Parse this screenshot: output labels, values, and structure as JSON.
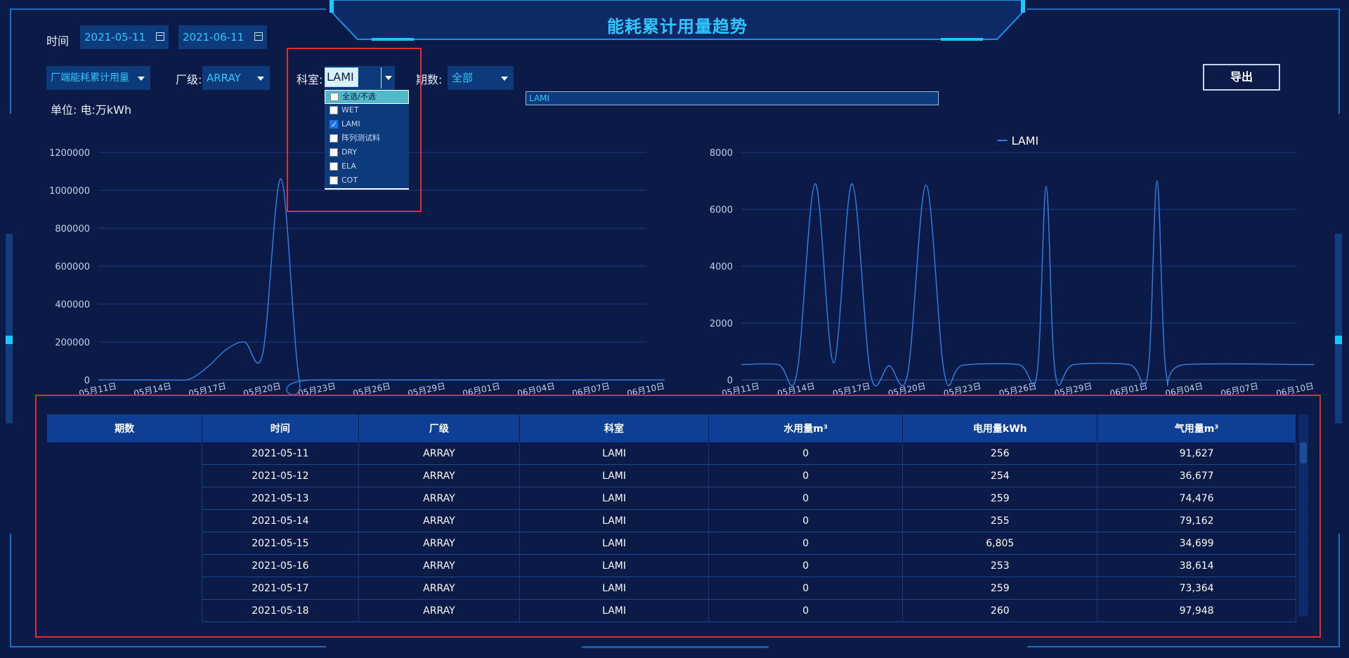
{
  "header": {
    "title": "能耗累计用量趋势"
  },
  "filters": {
    "time_label": "时间",
    "start_date": "2021-05-11",
    "end_date": "2021-06-11",
    "metric_select": "厂端能耗累计用量",
    "factory_label": "厂级:",
    "factory_value": "ARRAY",
    "dept_label": "科室:",
    "dept_value": "LAMI",
    "phase_label": "期数:",
    "phase_value": "全部",
    "export_label": "导出",
    "unit_label": "单位: 电:万kWh",
    "selected_chip": "LAMI"
  },
  "dept_dropdown": {
    "items": [
      {
        "label": "全选/不选",
        "checked": false
      },
      {
        "label": "WET",
        "checked": false
      },
      {
        "label": "LAMI",
        "checked": true
      },
      {
        "label": "阵列测试料",
        "checked": false
      },
      {
        "label": "DRY",
        "checked": false
      },
      {
        "label": "ELA",
        "checked": false
      },
      {
        "label": "COT",
        "checked": false
      }
    ]
  },
  "chart_data": [
    {
      "type": "line",
      "title": "",
      "x": [
        "05月11日",
        "05月14日",
        "05月17日",
        "05月20日",
        "05月23日",
        "05月26日",
        "05月29日",
        "06月01日",
        "06月04日",
        "06月07日",
        "06月10日"
      ],
      "y_ticks": [
        0,
        200000,
        400000,
        600000,
        800000,
        1000000,
        1200000
      ],
      "ylim": [
        0,
        1200000
      ],
      "series": [
        {
          "name": "",
          "color": "#2e7ee0",
          "points": [
            {
              "day": 0,
              "value": 0
            },
            {
              "day": 2,
              "value": 0
            },
            {
              "day": 4,
              "value": 0
            },
            {
              "day": 5,
              "value": 5000
            },
            {
              "day": 6,
              "value": 70000
            },
            {
              "day": 7,
              "value": 160000
            },
            {
              "day": 8,
              "value": 200000
            },
            {
              "day": 9,
              "value": 140000
            },
            {
              "day": 10,
              "value": 1060000
            },
            {
              "day": 11,
              "value": 0
            },
            {
              "day": 12,
              "value": 0
            },
            {
              "day": 31,
              "value": 0
            }
          ]
        }
      ]
    },
    {
      "type": "line",
      "title": "",
      "legend": "top-center",
      "x": [
        "05月11日",
        "05月14日",
        "05月17日",
        "05月20日",
        "05月23日",
        "05月26日",
        "05月29日",
        "06月01日",
        "06月04日",
        "06月07日",
        "06月10日"
      ],
      "y_ticks": [
        0,
        2000,
        4000,
        6000,
        8000
      ],
      "ylim": [
        0,
        8000
      ],
      "series": [
        {
          "name": "LAMI",
          "color": "#2e7ee0",
          "points": [
            {
              "day": 0,
              "value": 540
            },
            {
              "day": 2,
              "value": 540
            },
            {
              "day": 3,
              "value": 200
            },
            {
              "day": 4,
              "value": 6900
            },
            {
              "day": 5,
              "value": 600
            },
            {
              "day": 6,
              "value": 6900
            },
            {
              "day": 7,
              "value": 200
            },
            {
              "day": 8,
              "value": 500
            },
            {
              "day": 9,
              "value": 200
            },
            {
              "day": 10,
              "value": 6850
            },
            {
              "day": 11,
              "value": 200
            },
            {
              "day": 12,
              "value": 520
            },
            {
              "day": 15,
              "value": 540
            },
            {
              "day": 16,
              "value": 200
            },
            {
              "day": 16.5,
              "value": 6805
            },
            {
              "day": 17,
              "value": 200
            },
            {
              "day": 18,
              "value": 540
            },
            {
              "day": 21,
              "value": 540
            },
            {
              "day": 22,
              "value": 200
            },
            {
              "day": 22.5,
              "value": 7000
            },
            {
              "day": 23,
              "value": 200
            },
            {
              "day": 24,
              "value": 540
            },
            {
              "day": 31,
              "value": 540
            }
          ]
        }
      ]
    }
  ],
  "table": {
    "headers": [
      "期数",
      "时间",
      "厂级",
      "科室",
      "水用量m³",
      "电用量kWh",
      "气用量m³"
    ],
    "rows": [
      [
        "",
        "2021-05-11",
        "ARRAY",
        "LAMI",
        "0",
        "256",
        "91,627"
      ],
      [
        "",
        "2021-05-12",
        "ARRAY",
        "LAMI",
        "0",
        "254",
        "36,677"
      ],
      [
        "",
        "2021-05-13",
        "ARRAY",
        "LAMI",
        "0",
        "259",
        "74,476"
      ],
      [
        "",
        "2021-05-14",
        "ARRAY",
        "LAMI",
        "0",
        "255",
        "79,162"
      ],
      [
        "",
        "2021-05-15",
        "ARRAY",
        "LAMI",
        "0",
        "6,805",
        "34,699"
      ],
      [
        "",
        "2021-05-16",
        "ARRAY",
        "LAMI",
        "0",
        "253",
        "38,614"
      ],
      [
        "",
        "2021-05-17",
        "ARRAY",
        "LAMI",
        "0",
        "259",
        "73,364"
      ],
      [
        "",
        "2021-05-18",
        "ARRAY",
        "LAMI",
        "0",
        "260",
        "97,948"
      ]
    ]
  },
  "colors": {
    "background": "#0b1a47",
    "accent": "#2ec8ff",
    "highlight_box": "#e52b2b"
  }
}
